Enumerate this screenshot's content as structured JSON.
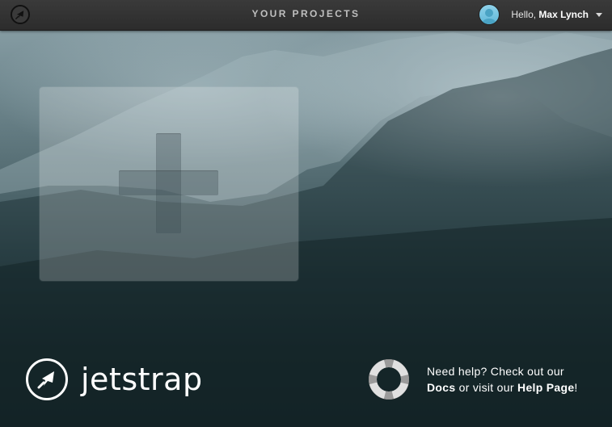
{
  "topbar": {
    "title": "YOUR PROJECTS",
    "greeting": "Hello,",
    "username": "Max Lynch"
  },
  "projects": {
    "new_project_icon": "plus-icon"
  },
  "brand": {
    "wordmark": "jetstrap",
    "icon": "jet-icon"
  },
  "help": {
    "line1": "Need help? Check out our",
    "docs_link": "Docs",
    "middle": "or visit our",
    "help_link": "Help Page",
    "end": "!",
    "icon": "lifebuoy-icon"
  },
  "colors": {
    "topbar": "#2c2c2c",
    "card": "rgba(255,255,255,0.22)",
    "avatar": "#6cc3e0"
  }
}
